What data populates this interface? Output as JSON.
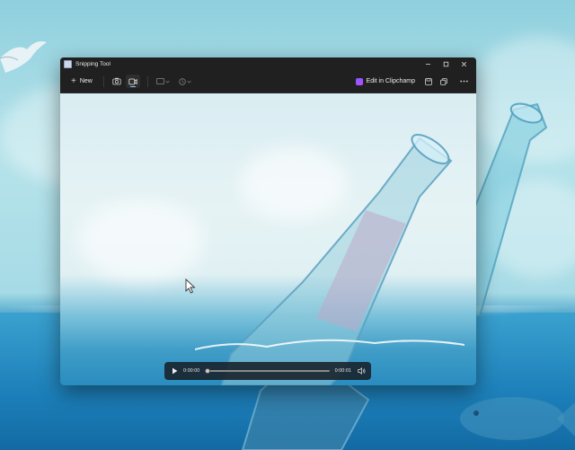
{
  "window": {
    "title": "Snipping Tool"
  },
  "toolbar": {
    "new_label": "New",
    "clipchamp_label": "Edit in Clipchamp"
  },
  "player": {
    "current_time": "0:00:00",
    "total_time": "0:00:01",
    "progress": 0.0
  },
  "icons": {
    "app": "snipping-tool-icon",
    "minimize": "minimize-icon",
    "maximize": "maximize-icon",
    "close": "close-icon",
    "camera": "camera-icon",
    "video": "video-camera-icon",
    "snip_mode": "rectangle-snip-icon",
    "delay": "timer-icon",
    "save": "save-icon",
    "copy": "copy-icon",
    "more": "more-options-icon",
    "play": "play-icon",
    "volume": "volume-icon"
  },
  "colors": {
    "accent": "#7fc4ff",
    "clipchamp": "#8a52ff",
    "window_bg": "#202020"
  }
}
